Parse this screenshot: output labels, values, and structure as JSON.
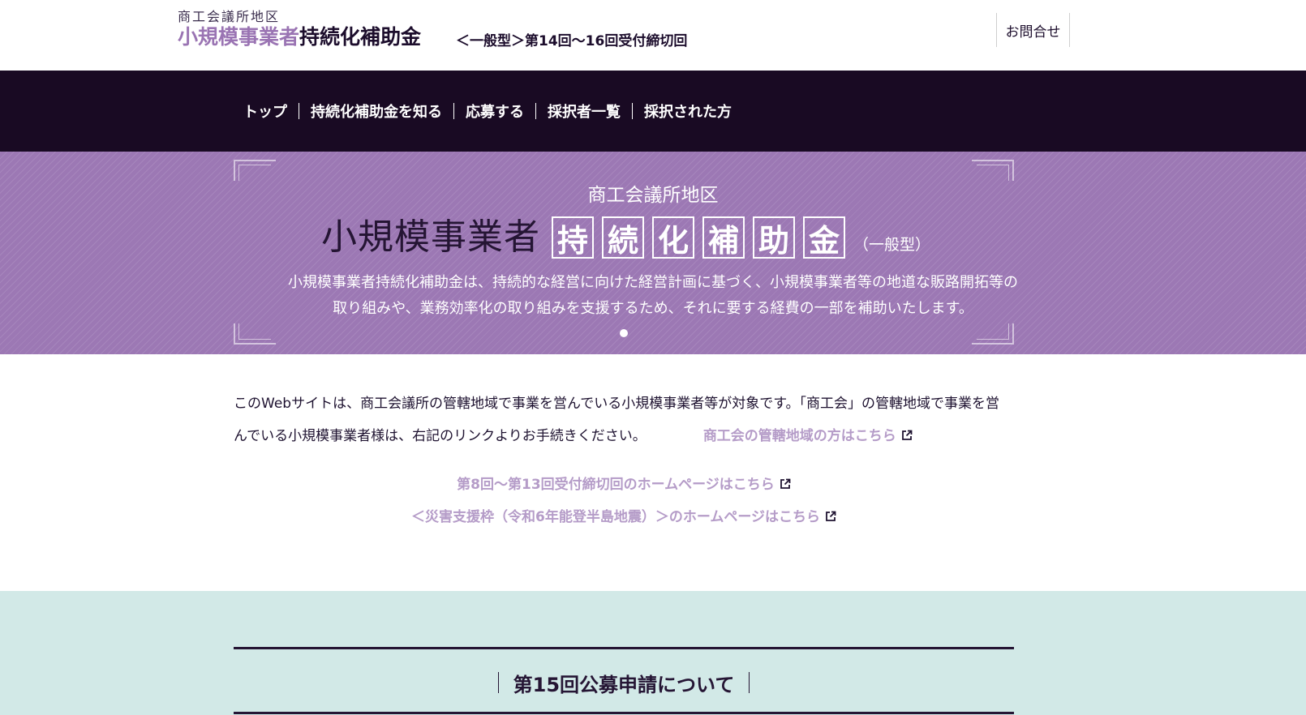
{
  "header": {
    "logo_sub": "商工会議所地区",
    "logo_main_purple": "小規模事業者",
    "logo_main_dark": "持続化補助金",
    "logo_round": "＜一般型＞第14回〜16回受付締切回",
    "contact_label": "お問合せ"
  },
  "nav": {
    "items": [
      {
        "label": "トップ"
      },
      {
        "label": "持続化補助金を知る"
      },
      {
        "label": "応募する"
      },
      {
        "label": "採択者一覧"
      },
      {
        "label": "採択された方"
      }
    ]
  },
  "hero": {
    "subtitle": "商工会議所地区",
    "title_lead": "小規模事業者",
    "title_boxed": [
      "持",
      "続",
      "化",
      "補",
      "助",
      "金"
    ],
    "title_type": "（一般型）",
    "desc_line1": "小規模事業者持続化補助金は、持続的な経営に向けた経営計画に基づく、小規模事業者等の地道な販路開拓等の",
    "desc_line2": "取り組みや、業務効率化の取り組みを支援するため、それに要する経費の一部を補助いたします。"
  },
  "intro": {
    "text": "このWebサイトは、商工会議所の管轄地域で事業を営んでいる小規模事業者等が対象です。「商工会」の管轄地域で事業を営んでいる小規模事業者様は、右記のリンクよりお手続きください。",
    "link_shokokai": "商工会の管轄地域の方はこちら"
  },
  "links": {
    "past_rounds": "第8回〜第13回受付締切回のホームページはこちら",
    "disaster": "＜災害支援枠（令和6年能登半島地震）＞のホームページはこちら"
  },
  "section": {
    "title": "第15回公募申請について"
  },
  "colors": {
    "nav_bg": "#190a23",
    "hero_bg": "#9c78b4",
    "accent_purple": "#9a74b3",
    "link_lavender": "#b59cc8",
    "section_bg": "#d2e9e7"
  }
}
